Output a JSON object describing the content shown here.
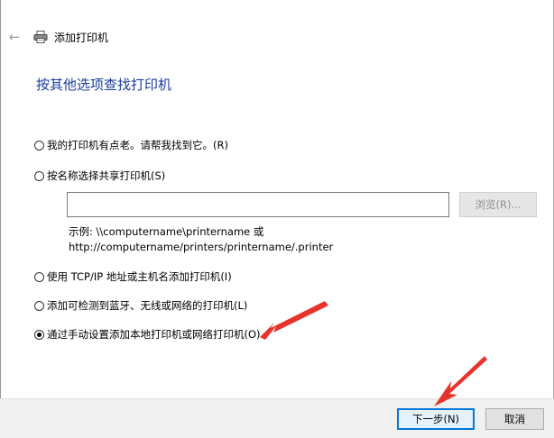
{
  "window": {
    "title": "添加打印机",
    "icons": {
      "back": "back-arrow-icon",
      "printer": "printer-icon"
    }
  },
  "page": {
    "heading": "按其他选项查找打印机"
  },
  "options": [
    {
      "label": "我的打印机有点老。请帮我找到它。(R)",
      "checked": false
    },
    {
      "label": "按名称选择共享打印机(S)",
      "checked": false
    },
    {
      "label": "使用 TCP/IP 地址或主机名添加打印机(I)",
      "checked": false
    },
    {
      "label": "添加可检测到蓝牙、无线或网络的打印机(L)",
      "checked": false
    },
    {
      "label": "通过手动设置添加本地打印机或网络打印机(O)",
      "checked": true
    }
  ],
  "share": {
    "input_value": "",
    "browse_label": "浏览(R)...",
    "example_line1": "示例: \\\\computername\\printername 或",
    "example_line2": "http://computername/printers/printername/.printer"
  },
  "footer": {
    "next_label": "下一步(N)",
    "cancel_label": "取消"
  },
  "annotations": {
    "arrow_color": "#e8332d"
  }
}
